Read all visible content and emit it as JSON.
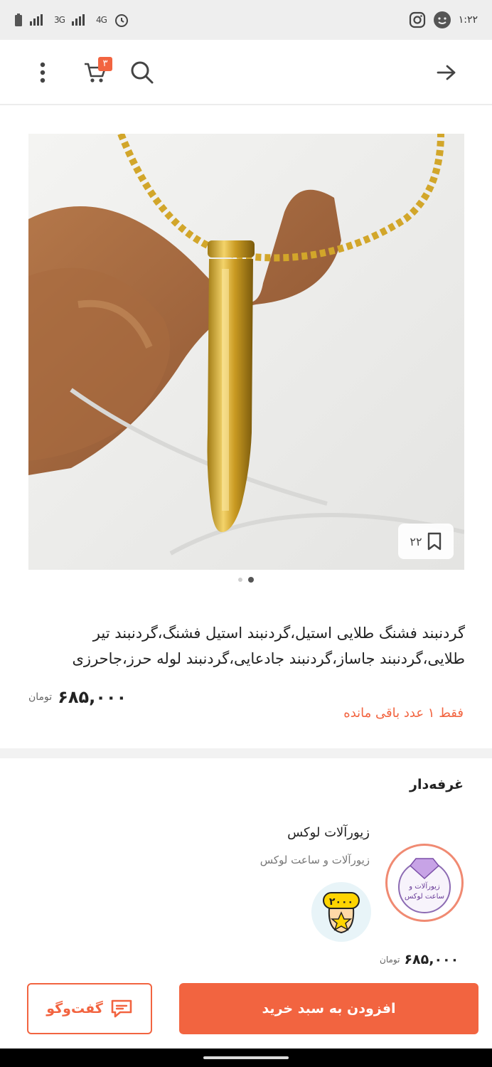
{
  "status_bar": {
    "time": "۱:۲۲",
    "network_1": "3G",
    "network_2": "4G",
    "right_icons": [
      "instagram-icon",
      "face-icon"
    ],
    "left_icons": [
      "battery-icon",
      "signal-icon",
      "alarm-icon"
    ]
  },
  "app_bar": {
    "cart_count": "۳",
    "icons": [
      "more-vert-icon",
      "cart-icon",
      "search-icon",
      "arrow-right-icon"
    ]
  },
  "gallery": {
    "bookmark_count": "۲۲",
    "page_count": 2,
    "active_page": 2
  },
  "product": {
    "title": "گردنبند فشنگ طلایی استیل،گردنبند استیل فشنگ،گردنبند تیر طلایی،گردنبند جاساز،گردنبند جادعایی،گردنبند لوله حرز،جاحرزی",
    "price": "۶۸۵,۰۰۰",
    "currency": "تومان",
    "stock_note": "فقط ۱ عدد باقی مانده"
  },
  "vendor": {
    "heading": "غرفه‌دار",
    "name": "زیورآلات لوکس",
    "subtitle": "زیورآلات و ساعت لوکس",
    "logo_text_1": "زیورآلات و",
    "logo_text_2": "ساعت لوکس",
    "badge_text": "۲۰۰۰",
    "price": "۶۸۵,۰۰۰",
    "currency": "تومان"
  },
  "actions": {
    "add_to_cart": "افزودن به سبد خرید",
    "chat": "گفت‌وگو"
  },
  "colors": {
    "accent": "#f26440",
    "status_bar_bg": "#eeeeee"
  }
}
